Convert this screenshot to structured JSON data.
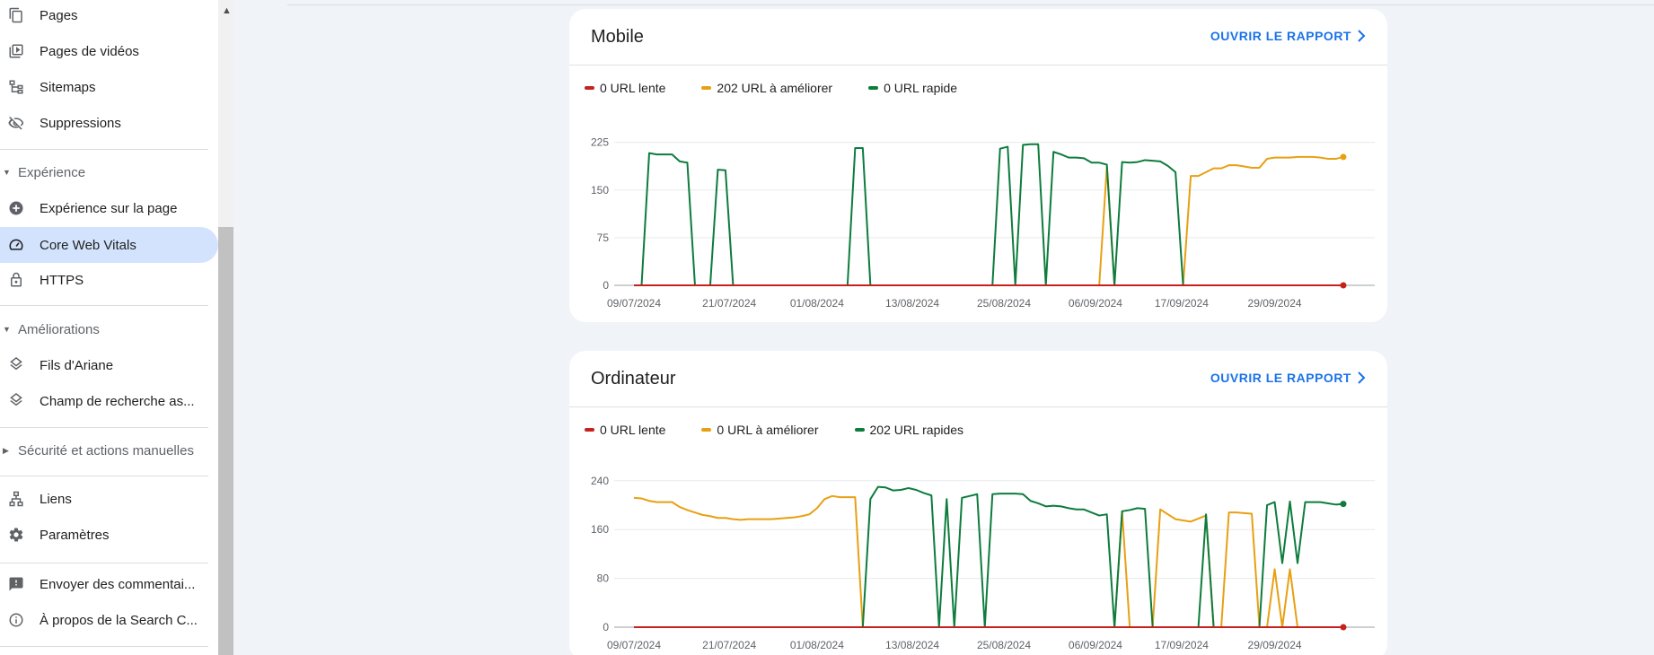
{
  "sidebar": {
    "items": [
      {
        "label": "Pages",
        "icon": "pages-icon"
      },
      {
        "label": "Pages de vidéos",
        "icon": "video-pages-icon"
      },
      {
        "label": "Sitemaps",
        "icon": "sitemap-icon"
      },
      {
        "label": "Suppressions",
        "icon": "eye-off-icon"
      }
    ],
    "section_experience": "Expérience",
    "experience_items": [
      {
        "label": "Expérience sur la page",
        "icon": "plus-circle-icon"
      },
      {
        "label": "Core Web Vitals",
        "icon": "speed-gauge-icon"
      },
      {
        "label": "HTTPS",
        "icon": "lock-icon"
      }
    ],
    "section_ameliorations": "Améliorations",
    "amelioration_items": [
      {
        "label": "Fils d'Ariane",
        "icon": "layers-icon"
      },
      {
        "label": "Champ de recherche as...",
        "icon": "layers-icon"
      }
    ],
    "section_securite": "Sécurité et actions manuelles",
    "bottom_items": [
      {
        "label": "Liens",
        "icon": "links-icon"
      },
      {
        "label": "Paramètres",
        "icon": "gear-icon"
      }
    ],
    "footer_items": [
      {
        "label": "Envoyer des commentai...",
        "icon": "feedback-icon"
      },
      {
        "label": "À propos de la Search C...",
        "icon": "info-icon"
      }
    ]
  },
  "colors": {
    "slow": "#c5221f",
    "improve": "#e8a013",
    "fast": "#0d7c3d",
    "accent": "#1a73e8",
    "active_bg": "#d3e3fd"
  },
  "mobile": {
    "title": "Mobile",
    "open_label": "OUVRIR LE RAPPORT",
    "legend": [
      "0 URL lente",
      "202 URL à améliorer",
      "0 URL rapide"
    ]
  },
  "desktop": {
    "title": "Ordinateur",
    "open_label": "OUVRIR LE RAPPORT",
    "legend": [
      "0 URL lente",
      "0 URL à améliorer",
      "202 URL rapides"
    ]
  },
  "chart_data": [
    {
      "type": "line",
      "title": "Mobile",
      "x_tick_labels": [
        "09/07/2024",
        "21/07/2024",
        "01/08/2024",
        "13/08/2024",
        "25/08/2024",
        "06/09/2024",
        "17/09/2024",
        "29/09/2024"
      ],
      "y_ticks": [
        0,
        75,
        150,
        225
      ],
      "ylim": [
        0,
        240
      ],
      "n_points": 94,
      "series": [
        {
          "name": "0 URL lente",
          "color": "#c5221f",
          "values": [
            [
              0,
              0
            ],
            [
              93,
              0
            ]
          ]
        },
        {
          "name": "202 URL à améliorer",
          "color": "#e8a013",
          "values": [
            [
              0,
              0
            ],
            [
              61,
              0
            ],
            [
              62,
              186
            ],
            [
              63,
              0
            ],
            [
              72,
              0
            ],
            [
              73,
              172
            ],
            [
              74,
              172
            ],
            [
              75,
              178
            ],
            [
              76,
              184
            ],
            [
              77,
              184
            ],
            [
              78,
              189
            ],
            [
              79,
              189
            ],
            [
              80,
              187
            ],
            [
              81,
              185
            ],
            [
              82,
              185
            ],
            [
              83,
              199
            ],
            [
              84,
              201
            ],
            [
              85,
              201
            ],
            [
              86,
              201
            ],
            [
              87,
              202
            ],
            [
              88,
              202
            ],
            [
              89,
              202
            ],
            [
              90,
              201
            ],
            [
              91,
              199
            ],
            [
              92,
              199
            ],
            [
              93,
              202
            ]
          ]
        },
        {
          "name": "0 URL rapide",
          "color": "#0d7c3d",
          "values": [
            [
              0,
              0
            ],
            [
              1,
              0
            ],
            [
              2,
              208
            ],
            [
              3,
              206
            ],
            [
              4,
              206
            ],
            [
              5,
              206
            ],
            [
              6,
              195
            ],
            [
              7,
              193
            ],
            [
              8,
              0
            ],
            [
              10,
              0
            ],
            [
              11,
              182
            ],
            [
              12,
              181
            ],
            [
              13,
              0
            ],
            [
              28,
              0
            ],
            [
              29,
              216
            ],
            [
              30,
              216
            ],
            [
              31,
              0
            ],
            [
              47,
              0
            ],
            [
              48,
              215
            ],
            [
              49,
              218
            ],
            [
              50,
              0
            ],
            [
              51,
              221
            ],
            [
              52,
              222
            ],
            [
              53,
              222
            ],
            [
              54,
              0
            ],
            [
              55,
              210
            ],
            [
              56,
              206
            ],
            [
              57,
              201
            ],
            [
              58,
              201
            ],
            [
              59,
              200
            ],
            [
              60,
              193
            ],
            [
              61,
              193
            ],
            [
              62,
              190
            ],
            [
              63,
              0
            ],
            [
              64,
              194
            ],
            [
              65,
              193
            ],
            [
              66,
              194
            ],
            [
              67,
              197
            ],
            [
              68,
              196
            ],
            [
              69,
              195
            ],
            [
              70,
              188
            ],
            [
              71,
              178
            ],
            [
              72,
              0
            ],
            [
              93,
              0
            ]
          ]
        }
      ]
    },
    {
      "type": "line",
      "title": "Ordinateur",
      "x_tick_labels": [
        "09/07/2024",
        "21/07/2024",
        "01/08/2024",
        "13/08/2024",
        "25/08/2024",
        "06/09/2024",
        "17/09/2024",
        "29/09/2024"
      ],
      "y_ticks": [
        0,
        80,
        160,
        240
      ],
      "ylim": [
        0,
        250
      ],
      "n_points": 94,
      "series": [
        {
          "name": "0 URL lente",
          "color": "#c5221f",
          "values": [
            [
              0,
              0
            ],
            [
              93,
              0
            ]
          ]
        },
        {
          "name": "0 URL à améliorer",
          "color": "#e8a013",
          "values": [
            [
              0,
              212
            ],
            [
              1,
              211
            ],
            [
              2,
              207
            ],
            [
              3,
              205
            ],
            [
              4,
              205
            ],
            [
              5,
              205
            ],
            [
              6,
              197
            ],
            [
              7,
              192
            ],
            [
              8,
              188
            ],
            [
              9,
              184
            ],
            [
              10,
              182
            ],
            [
              11,
              179
            ],
            [
              12,
              179
            ],
            [
              13,
              177
            ],
            [
              14,
              176
            ],
            [
              15,
              177
            ],
            [
              16,
              177
            ],
            [
              17,
              177
            ],
            [
              18,
              177
            ],
            [
              19,
              178
            ],
            [
              20,
              179
            ],
            [
              21,
              180
            ],
            [
              22,
              182
            ],
            [
              23,
              185
            ],
            [
              24,
              195
            ],
            [
              25,
              210
            ],
            [
              26,
              215
            ],
            [
              27,
              213
            ],
            [
              28,
              213
            ],
            [
              29,
              213
            ],
            [
              30,
              0
            ],
            [
              63,
              0
            ],
            [
              64,
              190
            ],
            [
              65,
              0
            ],
            [
              68,
              0
            ],
            [
              69,
              193
            ],
            [
              70,
              185
            ],
            [
              71,
              177
            ],
            [
              72,
              175
            ],
            [
              73,
              173
            ],
            [
              74,
              178
            ],
            [
              75,
              183
            ],
            [
              76,
              0
            ],
            [
              77,
              0
            ],
            [
              78,
              188
            ],
            [
              79,
              188
            ],
            [
              80,
              187
            ],
            [
              81,
              186
            ],
            [
              82,
              0
            ],
            [
              83,
              0
            ],
            [
              84,
              95
            ],
            [
              85,
              0
            ],
            [
              86,
              95
            ],
            [
              87,
              0
            ],
            [
              93,
              0
            ]
          ]
        },
        {
          "name": "202 URL rapides",
          "color": "#0d7c3d",
          "values": [
            [
              0,
              0
            ],
            [
              30,
              0
            ],
            [
              31,
              210
            ],
            [
              32,
              230
            ],
            [
              33,
              229
            ],
            [
              34,
              224
            ],
            [
              35,
              225
            ],
            [
              36,
              228
            ],
            [
              37,
              225
            ],
            [
              38,
              220
            ],
            [
              39,
              216
            ],
            [
              40,
              0
            ],
            [
              41,
              210
            ],
            [
              42,
              0
            ],
            [
              43,
              212
            ],
            [
              44,
              215
            ],
            [
              45,
              218
            ],
            [
              46,
              0
            ],
            [
              47,
              218
            ],
            [
              48,
              219
            ],
            [
              49,
              219
            ],
            [
              50,
              219
            ],
            [
              51,
              218
            ],
            [
              52,
              207
            ],
            [
              53,
              203
            ],
            [
              54,
              198
            ],
            [
              55,
              199
            ],
            [
              56,
              198
            ],
            [
              57,
              195
            ],
            [
              58,
              193
            ],
            [
              59,
              193
            ],
            [
              60,
              188
            ],
            [
              61,
              183
            ],
            [
              62,
              185
            ],
            [
              63,
              0
            ],
            [
              64,
              190
            ],
            [
              65,
              192
            ],
            [
              66,
              195
            ],
            [
              67,
              194
            ],
            [
              68,
              0
            ],
            [
              74,
              0
            ],
            [
              75,
              185
            ],
            [
              76,
              0
            ],
            [
              82,
              0
            ],
            [
              83,
              200
            ],
            [
              84,
              205
            ],
            [
              85,
              105
            ],
            [
              86,
              206
            ],
            [
              87,
              105
            ],
            [
              88,
              205
            ],
            [
              89,
              205
            ],
            [
              90,
              205
            ],
            [
              91,
              203
            ],
            [
              92,
              201
            ],
            [
              93,
              202
            ]
          ]
        }
      ]
    }
  ]
}
